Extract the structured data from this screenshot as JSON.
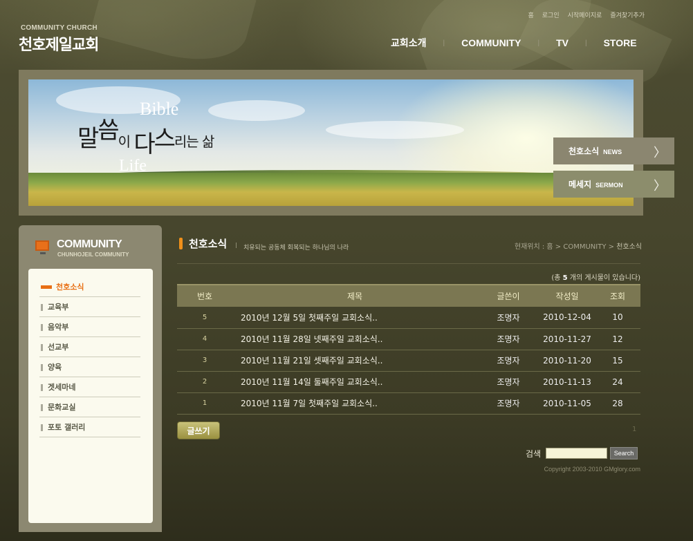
{
  "header": {
    "logo_small": "COMMUNITY CHURCH",
    "logo_main": "천호제일교회",
    "top_links": [
      "홈",
      "로그인",
      "시작페이지로",
      "즐겨찾기추가"
    ],
    "nav": [
      "교회소개",
      "COMMUNITY",
      "TV",
      "STORE"
    ],
    "nav_sep": "|"
  },
  "banner": {
    "main_1": "말",
    "main_2": "씀",
    "main_3": "이 ",
    "main_4": "다",
    "main_5": "스",
    "main_6": "리는 삶",
    "bible": "Bible",
    "life": "Life"
  },
  "quick": {
    "news_ko": "천호소식",
    "news_en": "NEWS",
    "sermon_ko": "메세지",
    "sermon_en": "SERMON",
    "chevron": "〉"
  },
  "sidebar": {
    "title": "COMMUNITY",
    "subtitle": "CHUNHOJEIL COMMUNITY",
    "items": [
      "천호소식",
      "교육부",
      "음악부",
      "선교부",
      "양육",
      "겟세마네",
      "문화교실",
      "포토 갤러리"
    ]
  },
  "content": {
    "title": "천호소식",
    "pipe": "|",
    "description": "치유되는 공동체 회복되는 하나님의 나라",
    "breadcrumb_prefix": "현재위치 : 홈 > COMMUNITY > ",
    "breadcrumb_current": "천호소식",
    "total_prefix": "(총 ",
    "total_count": "5",
    "total_suffix": " 개의 게시물이 있습니다)"
  },
  "table": {
    "headers": [
      "번호",
      "제목",
      "글쓴이",
      "작성일",
      "조회"
    ],
    "rows": [
      {
        "no": "5",
        "subject": "2010년 12월 5일 첫째주일 교회소식..",
        "author": "조명자",
        "date": "2010-12-04",
        "views": "10"
      },
      {
        "no": "4",
        "subject": "2010년 11월 28일 넷째주일 교회소식..",
        "author": "조명자",
        "date": "2010-11-27",
        "views": "12"
      },
      {
        "no": "3",
        "subject": "2010년 11월 21일 셋째주일 교회소식..",
        "author": "조명자",
        "date": "2010-11-20",
        "views": "15"
      },
      {
        "no": "2",
        "subject": "2010년 11월 14일 둘째주일 교회소식..",
        "author": "조명자",
        "date": "2010-11-13",
        "views": "24"
      },
      {
        "no": "1",
        "subject": "2010년 11월 7일 첫째주일 교회소식..",
        "author": "조명자",
        "date": "2010-11-05",
        "views": "28"
      }
    ]
  },
  "controls": {
    "write": "글쓰기",
    "page": "1",
    "search_label": "검색",
    "search_value": "",
    "search_button": "Search",
    "copyright": "Copyright 2003-2010 GMglory.com"
  }
}
